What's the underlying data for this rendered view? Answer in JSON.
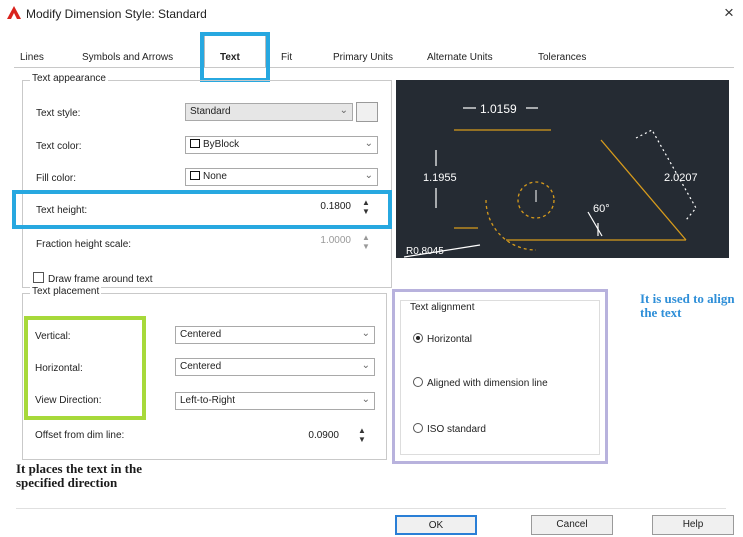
{
  "window": {
    "title": "Modify Dimension Style: Standard",
    "close_glyph": "×"
  },
  "tabs": [
    {
      "label": "Lines"
    },
    {
      "label": "Symbols and Arrows"
    },
    {
      "label": "Text"
    },
    {
      "label": "Fit"
    },
    {
      "label": "Primary Units"
    },
    {
      "label": "Alternate Units"
    },
    {
      "label": "Tolerances"
    }
  ],
  "text_appearance": {
    "legend": "Text appearance",
    "text_style": {
      "label": "Text style:",
      "value": "Standard"
    },
    "text_color": {
      "label": "Text color:",
      "value": "ByBlock"
    },
    "fill_color": {
      "label": "Fill color:",
      "value": "None"
    },
    "text_height": {
      "label": "Text height:",
      "value": "0.1800"
    },
    "fraction_height_scale": {
      "label": "Fraction height scale:",
      "value": "1.0000"
    },
    "draw_frame": {
      "label": "Draw frame around text",
      "checked": false
    }
  },
  "text_placement": {
    "legend": "Text placement",
    "vertical": {
      "label": "Vertical:",
      "value": "Centered"
    },
    "horizontal": {
      "label": "Horizontal:",
      "value": "Centered"
    },
    "view_direction": {
      "label": "View Direction:",
      "value": "Left-to-Right"
    },
    "offset": {
      "label": "Offset from dim line:",
      "value": "0.0900"
    }
  },
  "text_alignment": {
    "legend": "Text alignment",
    "options": [
      {
        "label": "Horizontal",
        "selected": true
      },
      {
        "label": "Aligned with dimension line",
        "selected": false
      },
      {
        "label": "ISO standard",
        "selected": false
      }
    ]
  },
  "preview": {
    "dim_top": "1.0159",
    "dim_left": "1.1955",
    "dim_right": "2.0207",
    "angle": "60°",
    "radius": "R0.8045"
  },
  "notes": {
    "alignment_note": "It is used to align the text",
    "placement_note": "It places the text in the specified direction"
  },
  "buttons": {
    "ok": "OK",
    "cancel": "Cancel",
    "help": "Help"
  },
  "colors": {
    "highlight_blue": "#27a8e0",
    "highlight_green": "#a7d93a",
    "highlight_purple": "#b8b2dd",
    "preview_bg": "#252b33",
    "dim_line": "#d79b1c"
  }
}
